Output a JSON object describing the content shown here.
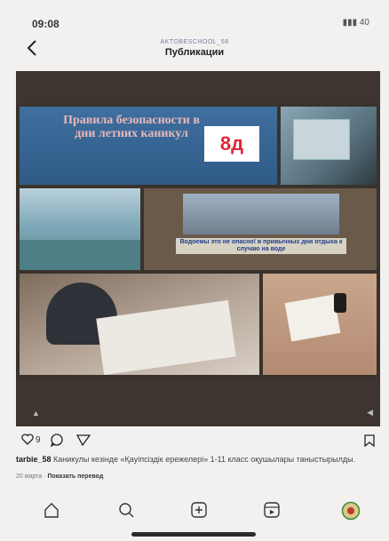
{
  "status_bar": {
    "time": "09:08",
    "signal_text": "40"
  },
  "header": {
    "account": "AKTOBESCHOOL_58",
    "title": "Публикации"
  },
  "post": {
    "slide_title": "Правила безопасности в дни летних каникул",
    "badge": "8д",
    "screen_caption": "Водоемы это не опасно! в привычных дни отдыха к случаю на воде",
    "likes": "9",
    "caption_user": "tarbie_58",
    "caption_text": "Каникулы кезінде «Қауіпсіздік ережелері» 1-11 класс оқушылары таныстырылды.",
    "date": "20 марта",
    "translate": "Показать перевод"
  },
  "icons": {
    "back": "chevron-left-icon",
    "like": "heart-icon",
    "comment": "comment-icon",
    "share": "paper-plane-icon",
    "save": "bookmark-icon",
    "home": "home-icon",
    "search": "search-icon",
    "create": "plus-square-icon",
    "reels": "reels-icon",
    "profile": "avatar-icon"
  },
  "colors": {
    "badge_text": "#e0293a",
    "slide_bg": "#3f6fa0",
    "background": "#f2f1ef"
  }
}
